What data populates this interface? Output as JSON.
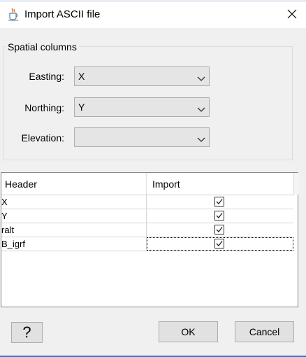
{
  "window": {
    "title": "Import ASCII file",
    "close_label": "✕"
  },
  "spatial": {
    "group_title": "Spatial columns",
    "easting": {
      "label": "Easting:",
      "value": "X"
    },
    "northing": {
      "label": "Northing:",
      "value": "Y"
    },
    "elevation": {
      "label": "Elevation:",
      "value": ""
    }
  },
  "table": {
    "headers": [
      "Header",
      "Import"
    ],
    "rows": [
      {
        "name": "X",
        "checked": true
      },
      {
        "name": "Y",
        "checked": true
      },
      {
        "name": "ralt",
        "checked": true
      },
      {
        "name": "B_igrf",
        "checked": true,
        "focused": true
      }
    ]
  },
  "buttons": {
    "help": "?",
    "ok": "OK",
    "cancel": "Cancel"
  },
  "icons": {
    "app": "java-cup-icon",
    "close": "close-icon",
    "dropdown": "chevron-down-icon",
    "checkbox": "checkmark-icon"
  }
}
